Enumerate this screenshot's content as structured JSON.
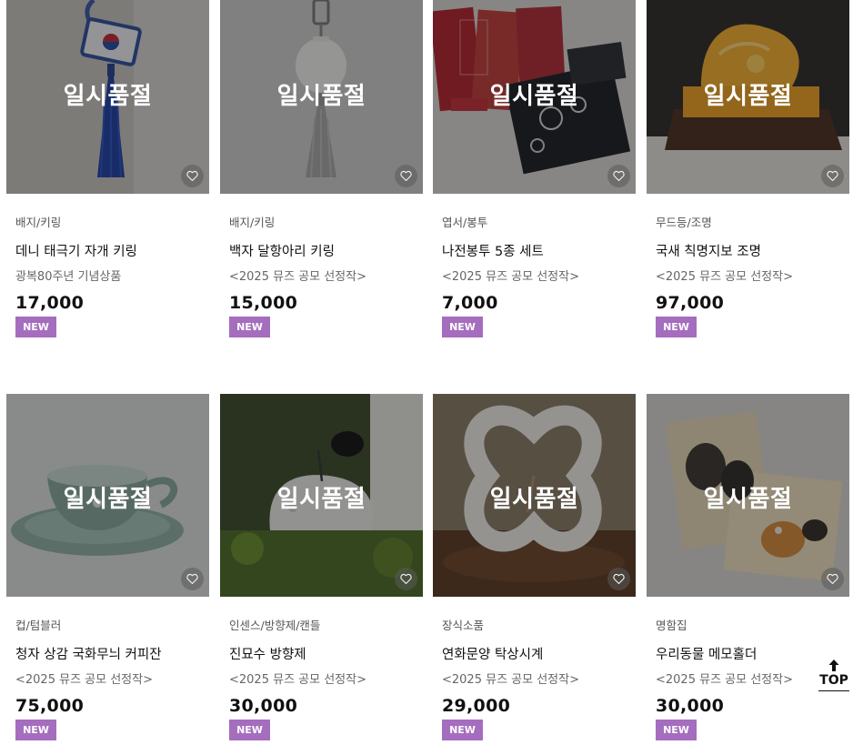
{
  "soldout_label": "일시품절",
  "top_label": "TOP",
  "products": [
    {
      "category": "배지/키링",
      "name": "데니 태극기 자개 키링",
      "subtitle": "광복80주년 기념상품",
      "price": "17,000",
      "badge": "NEW",
      "image": "taegukgi-keyring"
    },
    {
      "category": "배지/키링",
      "name": "백자 달항아리 키링",
      "subtitle": "<2025 뮤즈 공모 선정작>",
      "price": "15,000",
      "badge": "NEW",
      "image": "moon-jar-keyring"
    },
    {
      "category": "엽서/봉투",
      "name": "나전봉투 5종 세트",
      "subtitle": "<2025 뮤즈 공모 선정작>",
      "price": "7,000",
      "badge": "NEW",
      "image": "envelope-set"
    },
    {
      "category": "무드등/조명",
      "name": "국새 칙명지보 조명",
      "subtitle": "<2025 뮤즈 공모 선정작>",
      "price": "97,000",
      "badge": "NEW",
      "image": "royal-seal-lamp"
    },
    {
      "category": "컵/텀블러",
      "name": "청자 상감 국화무늬 커피잔",
      "subtitle": "<2025 뮤즈 공모 선정작>",
      "price": "75,000",
      "badge": "NEW",
      "image": "celadon-cup"
    },
    {
      "category": "인센스/방향제/캔들",
      "name": "진묘수 방향제",
      "subtitle": "<2025 뮤즈 공모 선정작>",
      "price": "30,000",
      "badge": "NEW",
      "image": "jinmyosu-diffuser"
    },
    {
      "category": "장식소품",
      "name": "연화문양 탁상시계",
      "subtitle": "<2025 뮤즈 공모 선정작>",
      "price": "29,000",
      "badge": "NEW",
      "image": "lotus-clock"
    },
    {
      "category": "명함집",
      "name": "우리동물 메모홀더",
      "subtitle": "<2025 뮤즈 공모 선정작>",
      "price": "30,000",
      "badge": "NEW",
      "image": "animal-memo-holder"
    }
  ],
  "colors": {
    "badge": "#a56dbe",
    "overlay": "rgba(20,20,20,0.42)"
  },
  "icons": {
    "wish": "heart-outline-icon",
    "top": "arrow-up-icon"
  }
}
